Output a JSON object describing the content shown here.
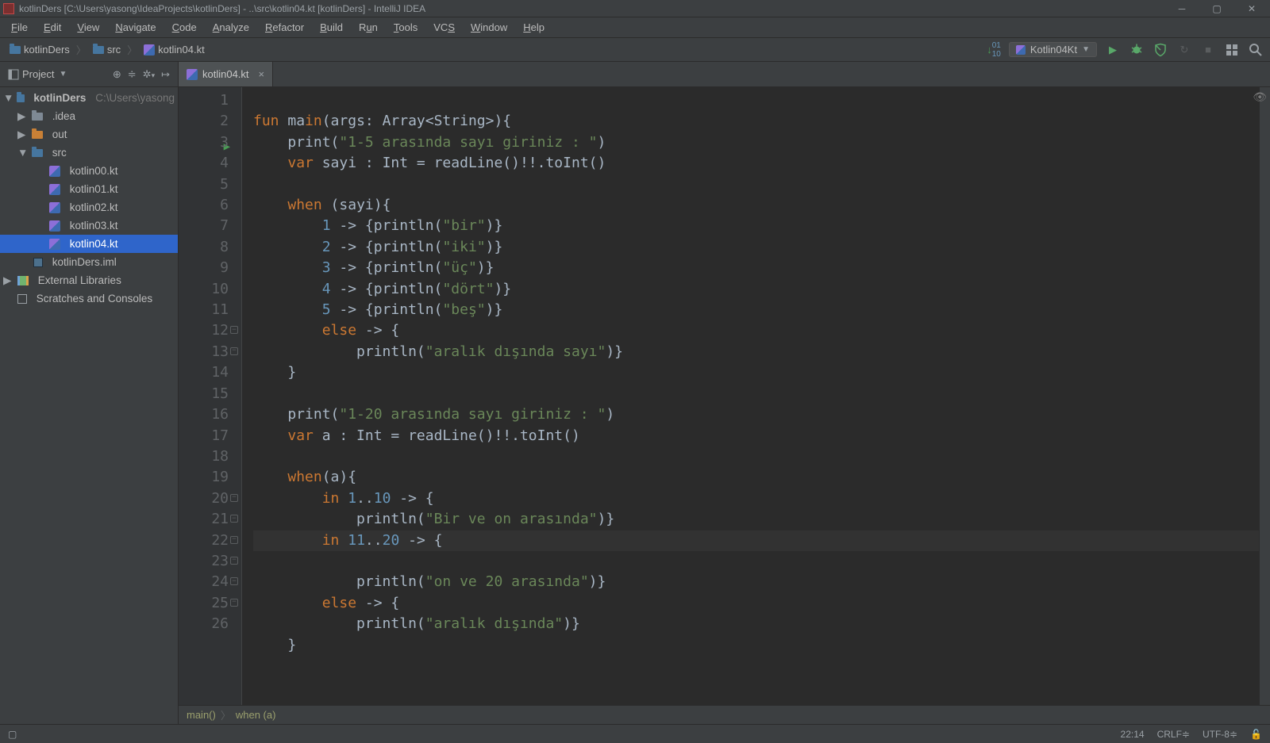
{
  "titlebar": {
    "text": "kotlinDers [C:\\Users\\yasong\\IdeaProjects\\kotlinDers] - ..\\src\\kotlin04.kt [kotlinDers] - IntelliJ IDEA"
  },
  "menu": {
    "file": "File",
    "edit": "Edit",
    "view": "View",
    "navigate": "Navigate",
    "code": "Code",
    "analyze": "Analyze",
    "refactor": "Refactor",
    "build": "Build",
    "run": "Run",
    "tools": "Tools",
    "vcs": "VCS",
    "window": "Window",
    "help": "Help"
  },
  "breadcrumbs": {
    "a": "kotlinDers",
    "b": "src",
    "c": "kotlin04.kt"
  },
  "runconfig": {
    "name": "Kotlin04Kt"
  },
  "project_panel": {
    "title": "Project"
  },
  "tab": {
    "label": "kotlin04.kt"
  },
  "tree": {
    "root": "kotlinDers",
    "root_path": "C:\\Users\\yasong",
    "idea": ".idea",
    "out": "out",
    "src": "src",
    "k0": "kotlin00.kt",
    "k1": "kotlin01.kt",
    "k2": "kotlin02.kt",
    "k3": "kotlin03.kt",
    "k4": "kotlin04.kt",
    "iml": "kotlinDers.iml",
    "ext": "External Libraries",
    "scr": "Scratches and Consoles"
  },
  "code": {
    "lines": [
      "",
      "fun main(args: Array<String>){",
      "    print(\"1-5 arasında sayı giriniz : \")",
      "    var sayi : Int = readLine()!!.toInt()",
      "",
      "    when (sayi){",
      "        1 -> {println(\"bir\")}",
      "        2 -> {println(\"iki\")}",
      "        3 -> {println(\"üç\")}",
      "        4 -> {println(\"dört\")}",
      "        5 -> {println(\"beş\")}",
      "        else -> {",
      "            println(\"aralık dışında sayı\")}",
      "    }",
      "",
      "    print(\"1-20 arasında sayı giriniz : \")",
      "    var a : Int = readLine()!!.toInt()",
      "",
      "    when(a){",
      "        in 1..10 -> {",
      "            println(\"Bir ve on arasında\")}",
      "        in 11..20 -> {",
      "            println(\"on ve 20 arasında\")}",
      "        else -> {",
      "            println(\"aralık dışında\")}",
      "    }"
    ]
  },
  "bottom_breadcrumb": {
    "a": "main()",
    "b": "when (a)"
  },
  "status": {
    "pos": "22:14",
    "crlf": "CRLF",
    "enc": "UTF-8"
  }
}
